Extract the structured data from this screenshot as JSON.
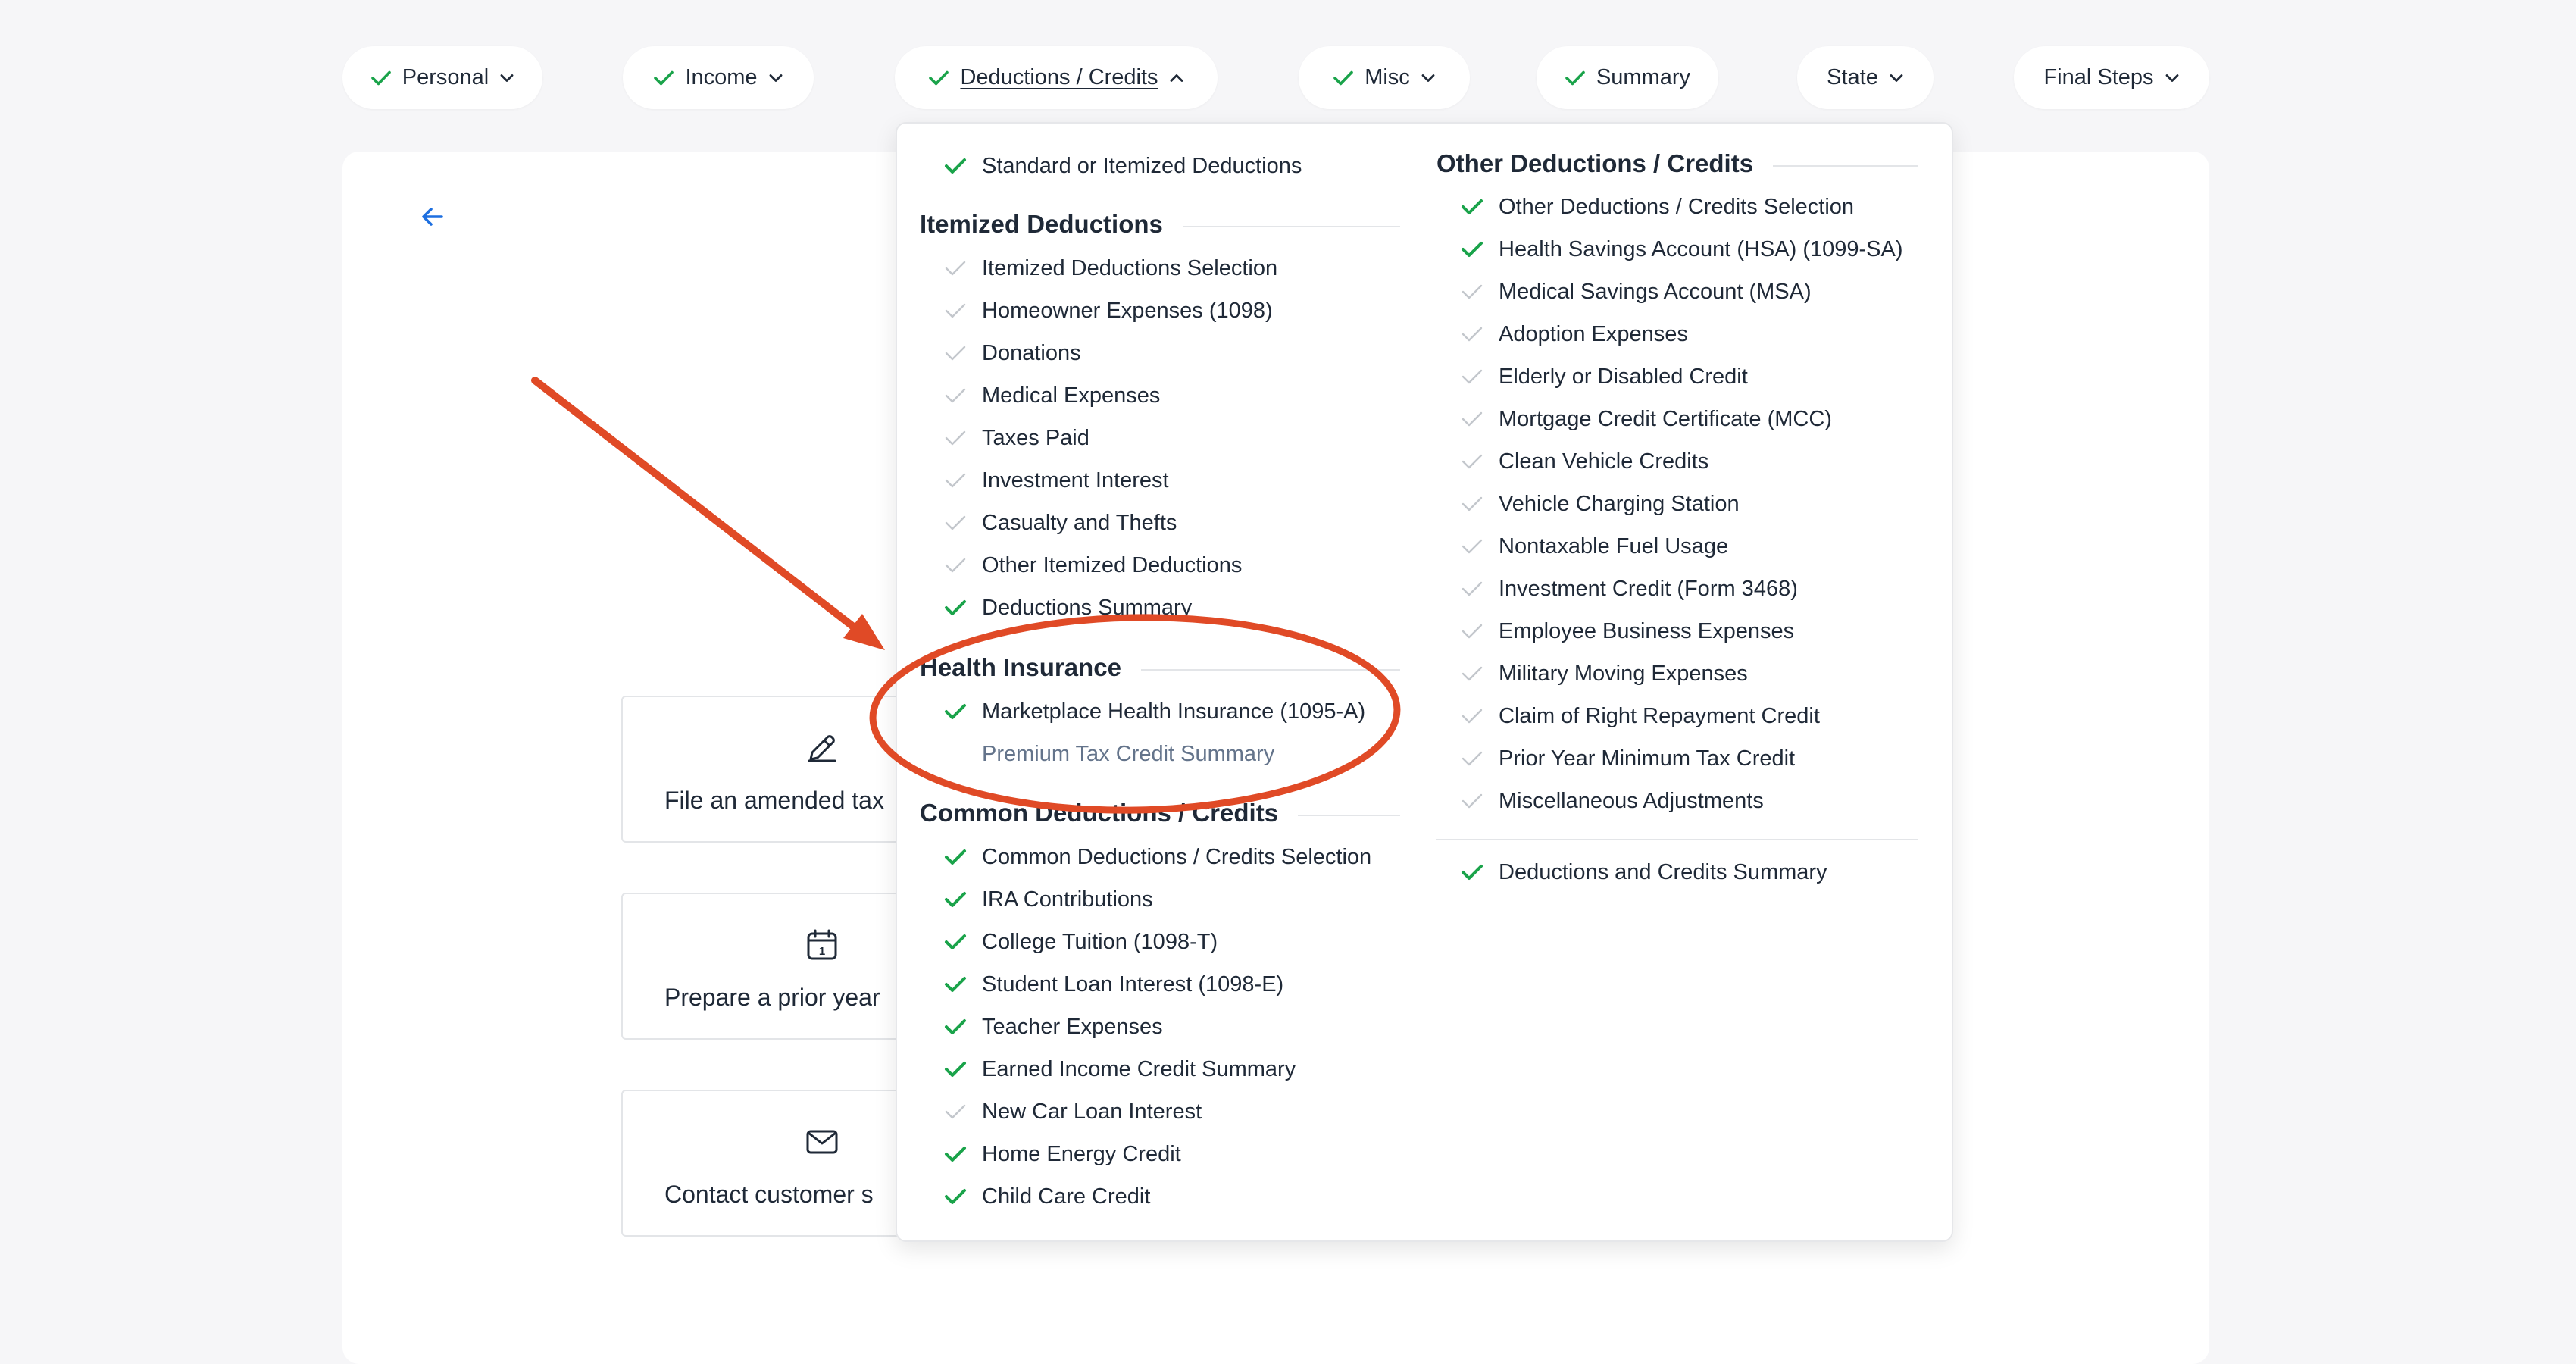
{
  "colors": {
    "accent_green": "#1aa34a",
    "check_gray": "#c3c7cc",
    "annotation_red": "#e04a26",
    "link_blue": "#1d6fe0"
  },
  "nav": {
    "items": [
      {
        "label": "Personal",
        "icon": "check-icon",
        "chevron": "chevron-down-icon"
      },
      {
        "label": "Income",
        "icon": "check-icon",
        "chevron": "chevron-down-icon"
      },
      {
        "label": "Deductions / Credits",
        "icon": "check-icon",
        "chevron": "chevron-up-icon"
      },
      {
        "label": "Misc",
        "icon": "check-icon",
        "chevron": "chevron-down-icon"
      },
      {
        "label": "Summary",
        "icon": "check-icon"
      },
      {
        "label": "State",
        "chevron": "chevron-down-icon"
      },
      {
        "label": "Final Steps",
        "chevron": "chevron-down-icon"
      }
    ]
  },
  "page": {
    "back_icon": "arrow-left-icon",
    "cards": [
      {
        "label": "File an amended tax",
        "icon": "pencil-icon"
      },
      {
        "label": "Prepare a prior year",
        "icon": "calendar-icon"
      },
      {
        "label": "Contact customer s",
        "icon": "mail-icon"
      }
    ]
  },
  "menu": {
    "col1": {
      "top_item": {
        "label": "Standard or Itemized Deductions",
        "done": true
      },
      "sections": [
        {
          "title": "Itemized Deductions",
          "items": [
            {
              "label": "Itemized Deductions Selection",
              "done": false
            },
            {
              "label": "Homeowner Expenses (1098)",
              "done": false
            },
            {
              "label": "Donations",
              "done": false
            },
            {
              "label": "Medical Expenses",
              "done": false
            },
            {
              "label": "Taxes Paid",
              "done": false
            },
            {
              "label": "Investment Interest",
              "done": false
            },
            {
              "label": "Casualty and Thefts",
              "done": false
            },
            {
              "label": "Other Itemized Deductions",
              "done": false
            },
            {
              "label": "Deductions Summary",
              "done": true
            }
          ]
        },
        {
          "title": "Health Insurance",
          "items": [
            {
              "label": "Marketplace Health Insurance (1095-A)",
              "done": true
            },
            {
              "label": "Premium Tax Credit Summary",
              "done": null
            }
          ]
        },
        {
          "title": "Common Deductions / Credits",
          "items": [
            {
              "label": "Common Deductions / Credits Selection",
              "done": true
            },
            {
              "label": "IRA Contributions",
              "done": true
            },
            {
              "label": "College Tuition (1098-T)",
              "done": true
            },
            {
              "label": "Student Loan Interest (1098-E)",
              "done": true
            },
            {
              "label": "Teacher Expenses",
              "done": true
            },
            {
              "label": "Earned Income Credit Summary",
              "done": true
            },
            {
              "label": "New Car Loan Interest",
              "done": false
            },
            {
              "label": "Home Energy Credit",
              "done": true
            },
            {
              "label": "Child Care Credit",
              "done": true
            }
          ]
        }
      ]
    },
    "col2": {
      "title": "Other Deductions / Credits",
      "items": [
        {
          "label": "Other Deductions / Credits Selection",
          "done": true
        },
        {
          "label": "Health Savings Account (HSA) (1099-SA)",
          "done": true
        },
        {
          "label": "Medical Savings Account (MSA)",
          "done": false
        },
        {
          "label": "Adoption Expenses",
          "done": false
        },
        {
          "label": "Elderly or Disabled Credit",
          "done": false
        },
        {
          "label": "Mortgage Credit Certificate (MCC)",
          "done": false
        },
        {
          "label": "Clean Vehicle Credits",
          "done": false
        },
        {
          "label": "Vehicle Charging Station",
          "done": false
        },
        {
          "label": "Nontaxable Fuel Usage",
          "done": false
        },
        {
          "label": "Investment Credit (Form 3468)",
          "done": false
        },
        {
          "label": "Employee Business Expenses",
          "done": false
        },
        {
          "label": "Military Moving Expenses",
          "done": false
        },
        {
          "label": "Claim of Right Repayment Credit",
          "done": false
        },
        {
          "label": "Prior Year Minimum Tax Credit",
          "done": false
        },
        {
          "label": "Miscellaneous Adjustments",
          "done": false
        }
      ],
      "bottom_item": {
        "label": "Deductions and Credits Summary",
        "done": true
      }
    }
  }
}
